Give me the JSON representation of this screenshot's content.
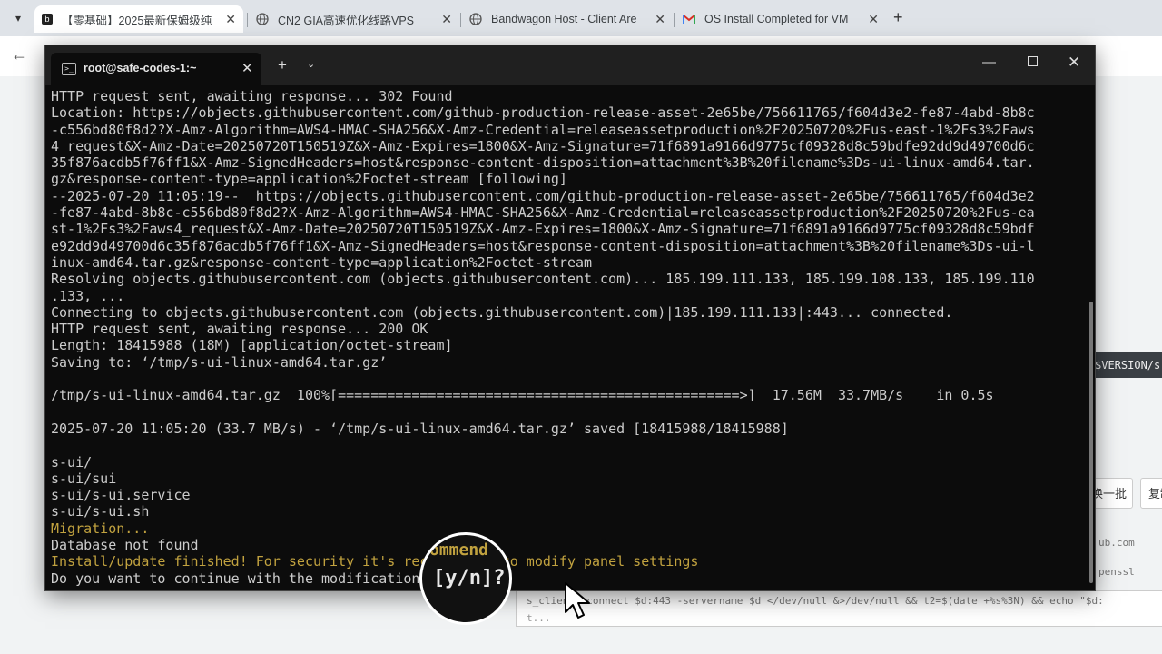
{
  "browser": {
    "tabs": [
      {
        "label": "【零基础】2025最新保姆级纯",
        "icon": "bilibili-icon",
        "active": true
      },
      {
        "label": "CN2 GIA高速优化线路VPS",
        "icon": "globe-icon",
        "active": false
      },
      {
        "label": "Bandwagon Host - Client Are",
        "icon": "globe-icon",
        "active": false
      },
      {
        "label": "OS Install Completed for VM",
        "icon": "gmail-icon",
        "active": false
      }
    ]
  },
  "background_page": {
    "code_snippet": "$VERSION/s",
    "button_1": "换一批",
    "button_2": "复制",
    "text_1": "ub.com",
    "text_2": "penssl",
    "command_line_1": "s_client -connect $d:443 -servername $d </dev/null &>/dev/null && t2=$(date +%s%3N) && echo \"$d:",
    "command_line_2": "t..."
  },
  "terminal": {
    "title": "root@safe-codes-1:~",
    "lines": [
      {
        "text": "HTTP request sent, awaiting response... 302 Found",
        "color": "white"
      },
      {
        "text": "Location: https://objects.githubusercontent.com/github-production-release-asset-2e65be/756611765/f604d3e2-fe87-4abd-8b8c",
        "color": "white"
      },
      {
        "text": "-c556bd80f8d2?X-Amz-Algorithm=AWS4-HMAC-SHA256&X-Amz-Credential=releaseassetproduction%2F20250720%2Fus-east-1%2Fs3%2Faws",
        "color": "white"
      },
      {
        "text": "4_request&X-Amz-Date=20250720T150519Z&X-Amz-Expires=1800&X-Amz-Signature=71f6891a9166d9775cf09328d8c59bdfe92dd9d49700d6c",
        "color": "white"
      },
      {
        "text": "35f876acdb5f76ff1&X-Amz-SignedHeaders=host&response-content-disposition=attachment%3B%20filename%3Ds-ui-linux-amd64.tar.",
        "color": "white"
      },
      {
        "text": "gz&response-content-type=application%2Foctet-stream [following]",
        "color": "white"
      },
      {
        "text": "--2025-07-20 11:05:19--  https://objects.githubusercontent.com/github-production-release-asset-2e65be/756611765/f604d3e2",
        "color": "white"
      },
      {
        "text": "-fe87-4abd-8b8c-c556bd80f8d2?X-Amz-Algorithm=AWS4-HMAC-SHA256&X-Amz-Credential=releaseassetproduction%2F20250720%2Fus-ea",
        "color": "white"
      },
      {
        "text": "st-1%2Fs3%2Faws4_request&X-Amz-Date=20250720T150519Z&X-Amz-Expires=1800&X-Amz-Signature=71f6891a9166d9775cf09328d8c59bdf",
        "color": "white"
      },
      {
        "text": "e92dd9d49700d6c35f876acdb5f76ff1&X-Amz-SignedHeaders=host&response-content-disposition=attachment%3B%20filename%3Ds-ui-l",
        "color": "white"
      },
      {
        "text": "inux-amd64.tar.gz&response-content-type=application%2Foctet-stream",
        "color": "white"
      },
      {
        "text": "Resolving objects.githubusercontent.com (objects.githubusercontent.com)... 185.199.111.133, 185.199.108.133, 185.199.110",
        "color": "white"
      },
      {
        "text": ".133, ...",
        "color": "white"
      },
      {
        "text": "Connecting to objects.githubusercontent.com (objects.githubusercontent.com)|185.199.111.133|:443... connected.",
        "color": "white"
      },
      {
        "text": "HTTP request sent, awaiting response... 200 OK",
        "color": "white"
      },
      {
        "text": "Length: 18415988 (18M) [application/octet-stream]",
        "color": "white"
      },
      {
        "text": "Saving to: ‘/tmp/s-ui-linux-amd64.tar.gz’",
        "color": "white"
      },
      {
        "text": "",
        "color": "white"
      },
      {
        "text": "/tmp/s-ui-linux-amd64.tar.gz  100%[=================================================>]  17.56M  33.7MB/s    in 0.5s",
        "color": "white"
      },
      {
        "text": "",
        "color": "white"
      },
      {
        "text": "2025-07-20 11:05:20 (33.7 MB/s) - ‘/tmp/s-ui-linux-amd64.tar.gz’ saved [18415988/18415988]",
        "color": "white"
      },
      {
        "text": "",
        "color": "white"
      },
      {
        "text": "s-ui/",
        "color": "white"
      },
      {
        "text": "s-ui/sui",
        "color": "white"
      },
      {
        "text": "s-ui/s-ui.service",
        "color": "white"
      },
      {
        "text": "s-ui/s-ui.sh",
        "color": "white"
      },
      {
        "text": "Migration...",
        "color": "yellow"
      },
      {
        "text": "Database not found",
        "color": "white"
      },
      {
        "text": "Install/update finished! For security it's recommended to modify panel settings",
        "color": "yellow"
      },
      {
        "text": "Do you want to continue with the modification [y/n]?",
        "color": "white"
      }
    ]
  },
  "magnifier": {
    "top_text": "ommend",
    "prompt_text": "[y/n]?"
  },
  "colors": {
    "terminal_bg": "#0c0c0c",
    "terminal_text": "#cccccc",
    "terminal_yellow": "#c1a23f"
  }
}
